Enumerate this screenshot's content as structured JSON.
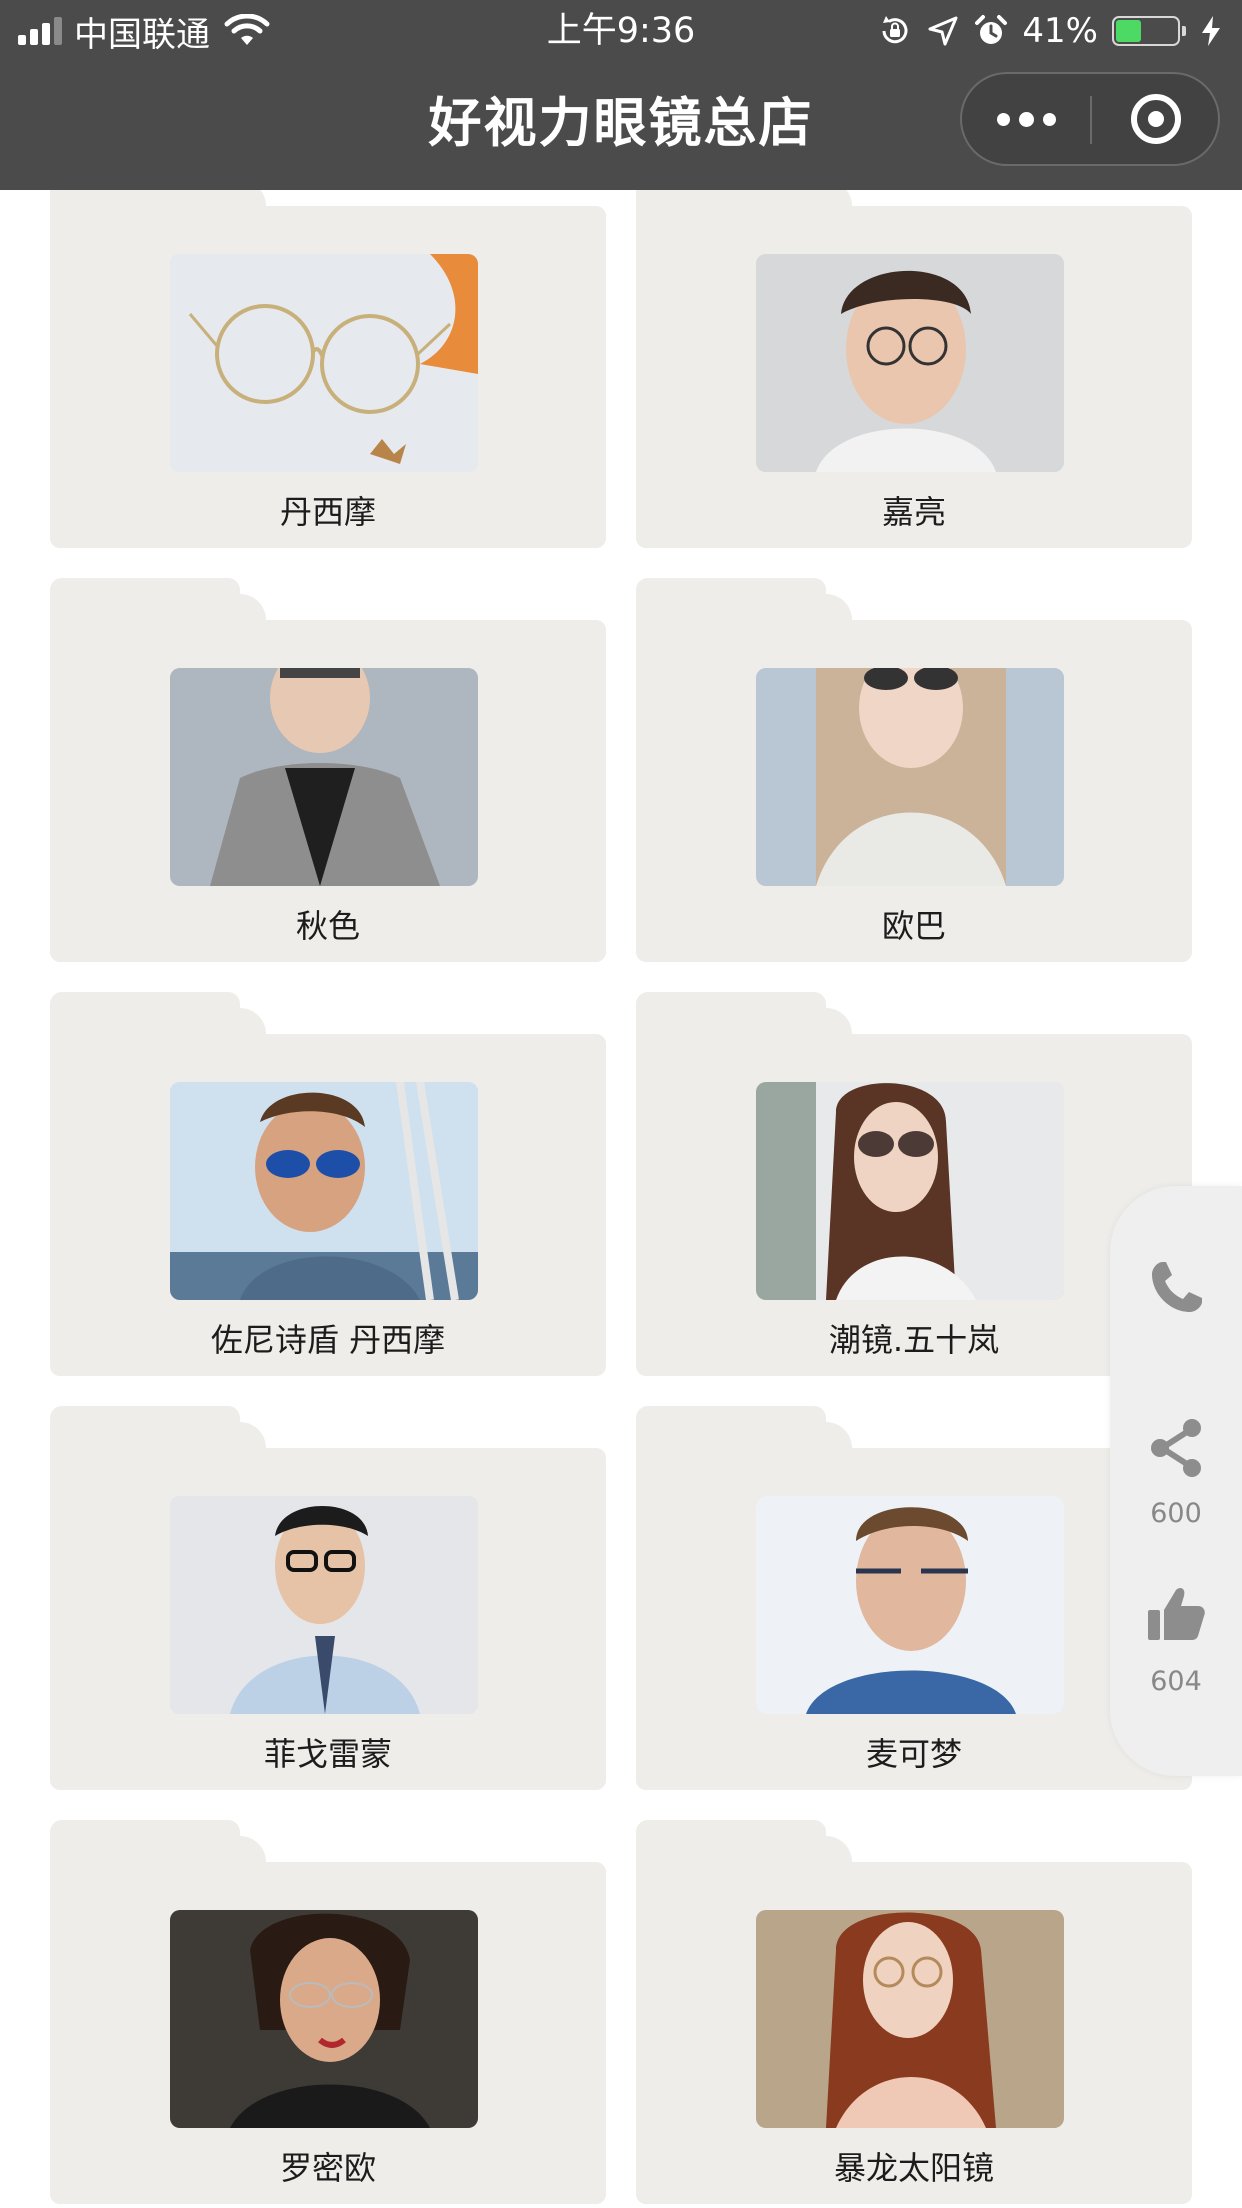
{
  "status_bar": {
    "carrier": "中国联通",
    "time": "上午9:36",
    "battery_percent": "41%",
    "battery_level": 0.41,
    "battery_color": "#4cd964"
  },
  "header": {
    "title": "好视力眼镜总店",
    "background": "#4b4b4b"
  },
  "capsule": {
    "more_icon": "ellipsis-icon",
    "close_icon": "target-icon"
  },
  "brands": [
    {
      "label": "丹西摩",
      "photo": "clear-frame-glasses-product-photo"
    },
    {
      "label": "嘉亮",
      "photo": "young-man-wearing-glasses-photo"
    },
    {
      "label": "秋色",
      "photo": "man-in-grey-blazer-sunglasses-photo"
    },
    {
      "label": "欧巴",
      "photo": "woman-in-sunglasses-photo"
    },
    {
      "label": "佐尼诗盾 丹西摩",
      "photo": "man-in-blue-mirrored-sunglasses-photo"
    },
    {
      "label": "潮镜.五十岚",
      "photo": "woman-in-tinted-sunglasses-photo"
    },
    {
      "label": "菲戈雷蒙",
      "photo": "man-in-black-frame-glasses-photo"
    },
    {
      "label": "麦可梦",
      "photo": "man-in-half-rim-glasses-photo"
    },
    {
      "label": "罗密欧",
      "photo": "woman-in-rimless-glasses-photo"
    },
    {
      "label": "暴龙太阳镜",
      "photo": "woman-in-round-glasses-photo"
    }
  ],
  "floating_actions": {
    "phone_icon": "phone-icon",
    "share_icon": "share-icon",
    "share_count": "600",
    "like_icon": "thumbs-up-icon",
    "like_count": "604"
  },
  "colors": {
    "card_background": "#eeede9",
    "fab_background": "#efefef",
    "fab_icon": "#8d8d8d"
  }
}
